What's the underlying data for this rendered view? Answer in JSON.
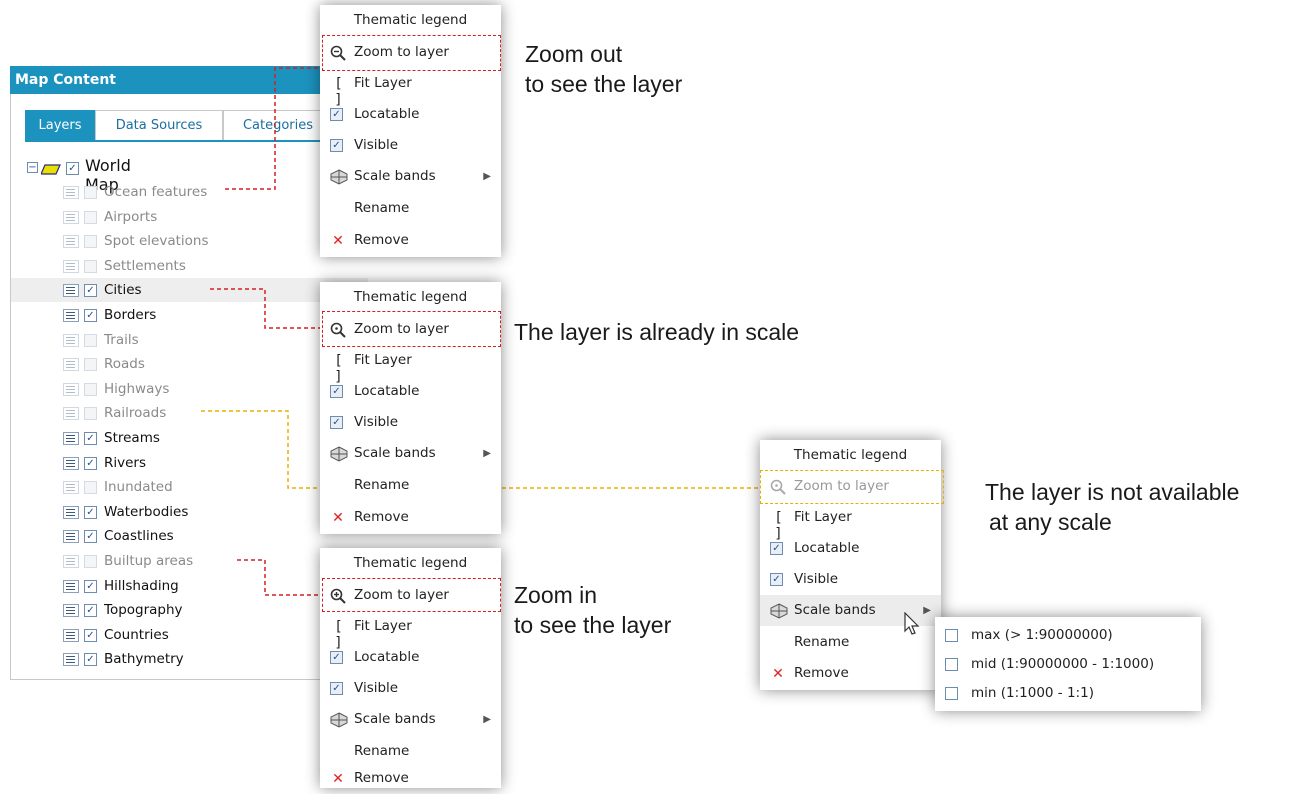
{
  "panel": {
    "title": "Map Content",
    "tabs": [
      "Layers",
      "Data Sources",
      "Categories"
    ],
    "root_label": "World Map",
    "layers": [
      {
        "label": "Ocean features",
        "enabled": false
      },
      {
        "label": "Airports",
        "enabled": false
      },
      {
        "label": "Spot elevations",
        "enabled": false
      },
      {
        "label": "Settlements",
        "enabled": false
      },
      {
        "label": "Cities",
        "enabled": true
      },
      {
        "label": "Borders",
        "enabled": true
      },
      {
        "label": "Trails",
        "enabled": false
      },
      {
        "label": "Roads",
        "enabled": false
      },
      {
        "label": "Highways",
        "enabled": false
      },
      {
        "label": "Railroads",
        "enabled": false
      },
      {
        "label": "Streams",
        "enabled": true
      },
      {
        "label": "Rivers",
        "enabled": true
      },
      {
        "label": "Inundated",
        "enabled": false
      },
      {
        "label": "Waterbodies",
        "enabled": true
      },
      {
        "label": "Coastlines",
        "enabled": true
      },
      {
        "label": "Builtup areas",
        "enabled": false
      },
      {
        "label": "Hillshading",
        "enabled": true
      },
      {
        "label": "Topography",
        "enabled": true
      },
      {
        "label": "Countries",
        "enabled": true
      },
      {
        "label": "Bathymetry",
        "enabled": true
      }
    ]
  },
  "menu": {
    "thematic_legend": "Thematic legend",
    "zoom_to_layer": "Zoom to layer",
    "fit_layer": "Fit Layer",
    "locatable": "Locatable",
    "visible": "Visible",
    "scale_bands": "Scale bands",
    "rename": "Rename",
    "remove": "Remove",
    "checkmark": "✓"
  },
  "submenu": {
    "items": [
      "max (> 1:90000000)",
      "mid (1:90000000 - 1:1000)",
      "min (1:1000 - 1:1)"
    ]
  },
  "annotations": {
    "zoom_out_1": "Zoom out",
    "zoom_out_2": "to see the layer",
    "in_scale": "The layer is already in scale",
    "not_available_1": "The layer is not available",
    "not_available_2": "at any scale",
    "zoom_in_1": "Zoom in",
    "zoom_in_2": "to see the layer"
  },
  "colors": {
    "header": "#1c93bf",
    "red_dash": "#d42020",
    "orange_dash": "#e8b000",
    "remove_x": "#e02020"
  }
}
